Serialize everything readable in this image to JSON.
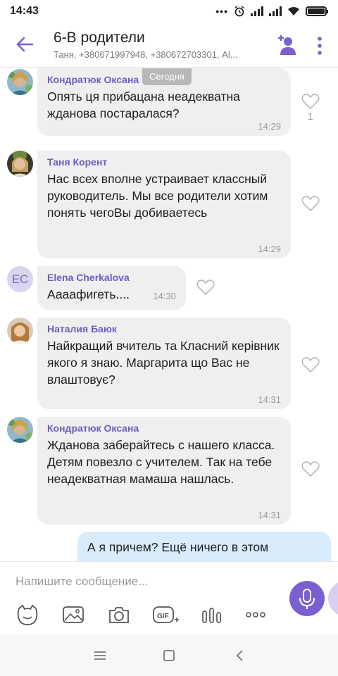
{
  "status_bar": {
    "time": "14:43",
    "overflow_indicator": "•••"
  },
  "header": {
    "title": "6-В родители",
    "subtitle": "Таня, +380671997948, +380672703301, Al..."
  },
  "date_chip": "Сегодня",
  "messages": [
    {
      "sender": "Кондратюк Оксана",
      "text": "Опять ця прибацана неадекватна жданова постаралася?",
      "time": "14:29",
      "likes": "1"
    },
    {
      "sender": "Таня Корент",
      "text": "Нас всех вполне устраивает классный руководитель. Мы все родители хотим понять чегоВы добиваетесь",
      "time": "14:29"
    },
    {
      "sender": "Elena Cherkalova",
      "avatar_initials": "EC",
      "text": "Аааафигеть....",
      "time": "14:30"
    },
    {
      "sender": "Наталия Баюк",
      "text": "Найкращий вчитель та Класний керівник якого я знаю. Маргарита що Вас не влаштовує?",
      "time": "14:31"
    },
    {
      "sender": "Кондратюк Оксана",
      "text": "Жданова заберайтесь с нашего класса. Детям повезло с учителем. Так на тебе неадекватная мамаша нашлась.",
      "time": "14:31"
    }
  ],
  "outgoing": {
    "text": "А я причем? Ещё ничего в этом"
  },
  "composer": {
    "placeholder": "Напишите сообщение...",
    "tools": [
      "sticker-icon",
      "gallery-icon",
      "camera-icon",
      "gif-icon",
      "poll-icon",
      "more-icon"
    ]
  },
  "colors": {
    "accent": "#7a5fd1",
    "sender_name": "#6f5bc2",
    "incoming_bubble": "#efefef",
    "outgoing_bubble": "#d9ecfb"
  }
}
